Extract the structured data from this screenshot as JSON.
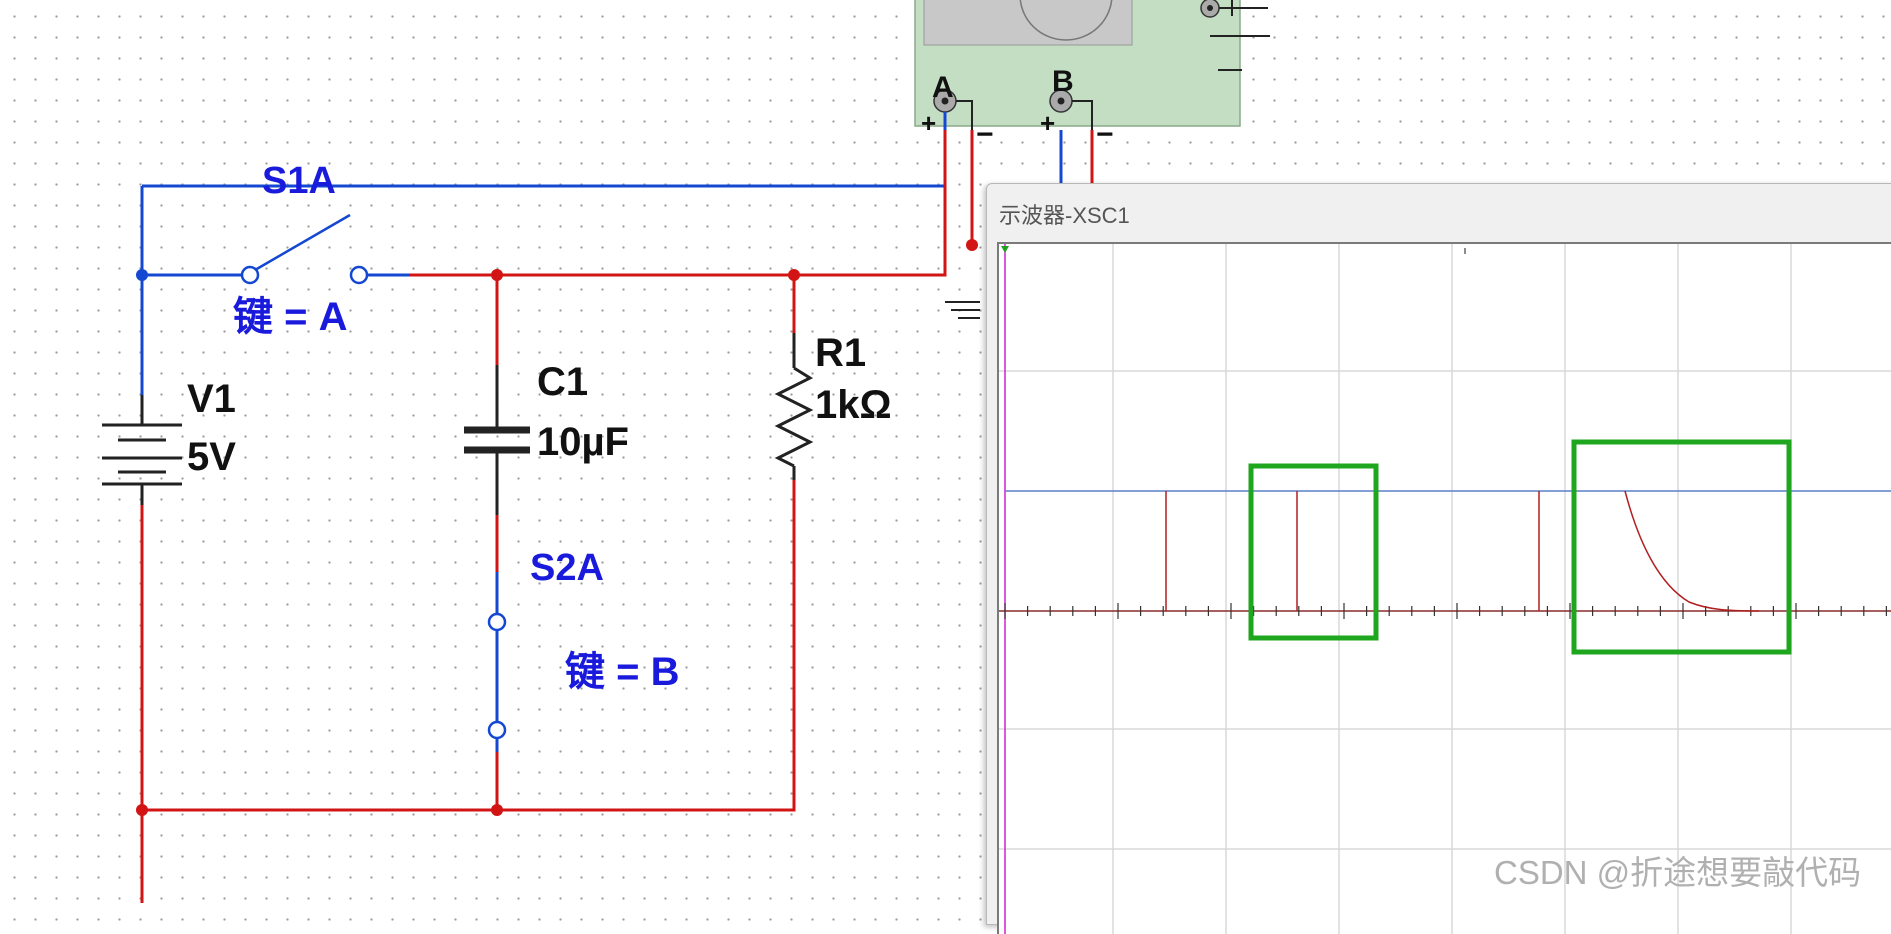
{
  "components": {
    "switch1": {
      "name": "S1A",
      "key": "键 = A"
    },
    "switch2": {
      "name": "S2A",
      "key": "键 = B"
    },
    "battery": {
      "name": "V1",
      "value": "5V"
    },
    "capacitor": {
      "name": "C1",
      "value": "10µF"
    },
    "resistor": {
      "name": "R1",
      "value": "1kΩ"
    }
  },
  "oscilloscope_symbol": {
    "channel_a": "A",
    "channel_b": "B",
    "plus": "+",
    "minus": "−"
  },
  "scope_window": {
    "title": "示波器-XSC1"
  },
  "colors": {
    "wire_red": "#d21414",
    "wire_blue": "#1448d2",
    "highlight_green": "#1fa61f",
    "scope_bg": "#c3dec3"
  },
  "watermark": "CSDN @折途想要敲代码"
}
